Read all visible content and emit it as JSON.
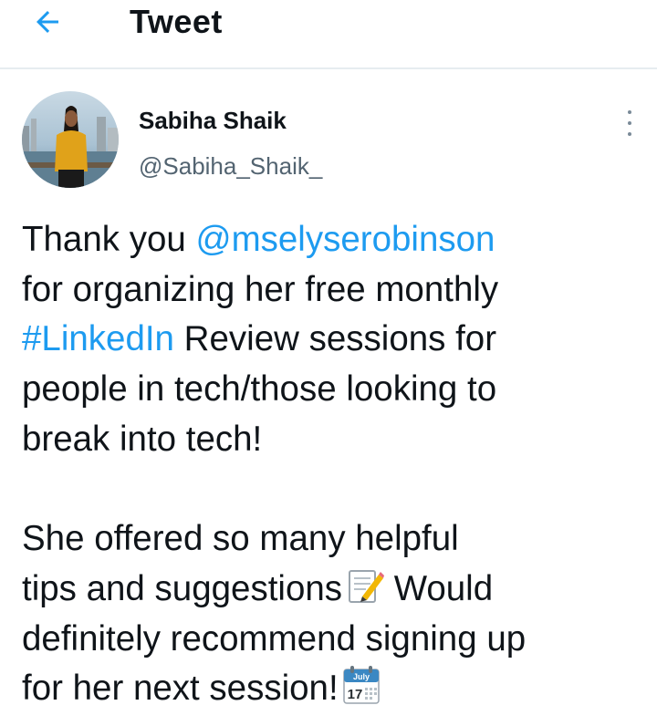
{
  "header": {
    "title": "Tweet",
    "back_icon": "arrow-left-icon"
  },
  "author": {
    "name": "Sabiha Shaik",
    "handle": "@Sabiha_Shaik_",
    "avatar_icon": "avatar"
  },
  "more_icon": "more-vertical-icon",
  "tweet": {
    "line1": {
      "text_before": "Thank you ",
      "mention": "@mselyserobinson"
    },
    "line2": "for organizing her free monthly",
    "line3": {
      "hashtag": "#LinkedIn",
      "text_after": " Review sessions for"
    },
    "line4": "people in tech/those looking to",
    "line5": "break into tech!",
    "line6": "She offered so many helpful",
    "line7": {
      "text": "tips and suggestions",
      "after": " Would"
    },
    "line8": "definitely recommend signing up",
    "line9": "for her next session!",
    "calendar": {
      "month": "July",
      "day": "17"
    }
  },
  "colors": {
    "link": "#1d9bf0",
    "secondary_text": "#536471",
    "primary_text": "#0f1419",
    "divider": "#e6ecf0"
  }
}
